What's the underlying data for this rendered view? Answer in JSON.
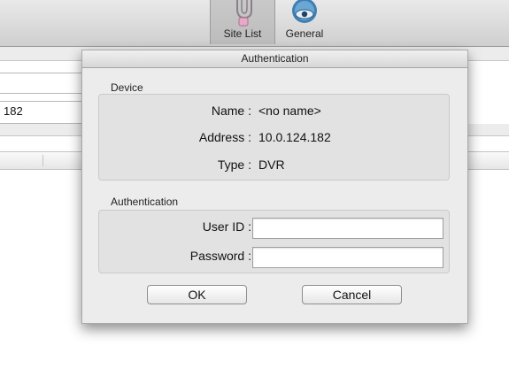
{
  "toolbar": {
    "site_list_label": "Site List",
    "general_label": "General"
  },
  "background": {
    "address_partial": "182"
  },
  "dialog": {
    "title": "Authentication",
    "device_group_label": "Device",
    "name_label": "Name :",
    "name_value": "<no name>",
    "address_label": "Address :",
    "address_value": "10.0.124.182",
    "type_label": "Type :",
    "type_value": "DVR",
    "auth_group_label": "Authentication",
    "user_id_label": "User ID :",
    "user_id_value": "",
    "password_label": "Password :",
    "password_value": "",
    "ok_label": "OK",
    "cancel_label": "Cancel"
  }
}
